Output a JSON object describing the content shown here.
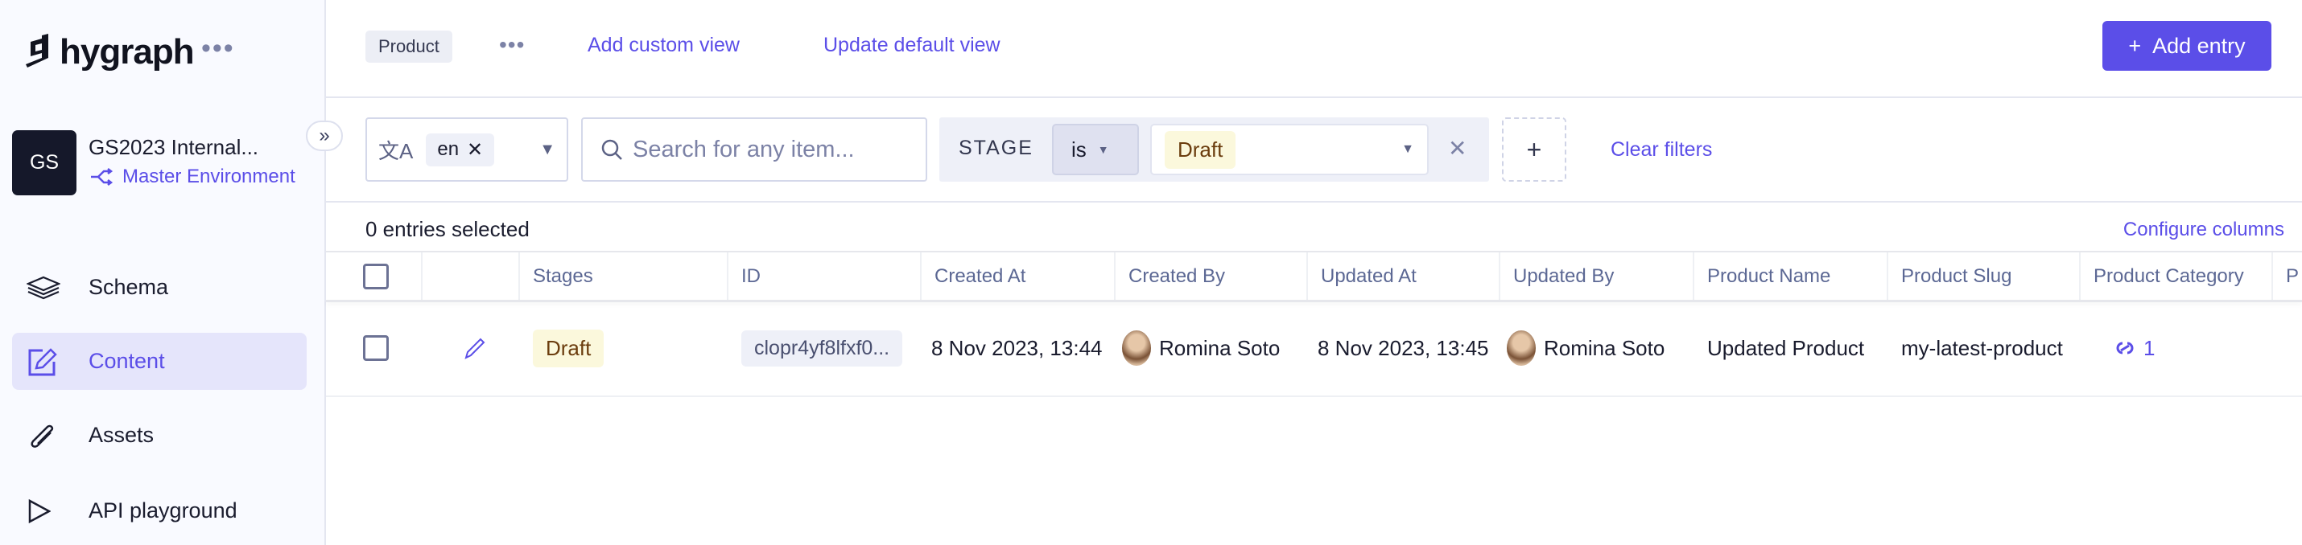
{
  "sidebar": {
    "brand": "hygraph",
    "project_initials": "GS",
    "project_name": "GS2023 Internal...",
    "environment": "Master Environment",
    "items": [
      {
        "label": "Schema",
        "icon": "layers-icon"
      },
      {
        "label": "Content",
        "icon": "edit-icon",
        "active": true
      },
      {
        "label": "Assets",
        "icon": "paperclip-icon"
      },
      {
        "label": "API playground",
        "icon": "play-icon"
      }
    ]
  },
  "header": {
    "model_tag": "Product",
    "add_custom_view": "Add custom view",
    "update_default_view": "Update default view",
    "add_entry": "Add entry"
  },
  "filters": {
    "locale": "en",
    "search_placeholder": "Search for any item...",
    "stage_label": "STAGE",
    "operator": "is",
    "stage_value": "Draft",
    "clear": "Clear filters"
  },
  "table": {
    "selected_text": "0 entries selected",
    "configure_columns": "Configure columns",
    "columns": [
      "",
      "",
      "Stages",
      "ID",
      "Created At",
      "Created By",
      "Updated At",
      "Updated By",
      "Product Name",
      "Product Slug",
      "Product Category",
      "P"
    ],
    "rows": [
      {
        "stage": "Draft",
        "id": "clopr4yf8lfxf0...",
        "created_at": "8 Nov 2023, 13:44",
        "created_by": "Romina Soto",
        "updated_at": "8 Nov 2023, 13:45",
        "updated_by": "Romina Soto",
        "product_name": "Updated Product",
        "product_slug": "my-latest-product",
        "product_category": "1"
      }
    ]
  },
  "colors": {
    "accent": "#5b4ee8",
    "draft_bg": "#fbf8dc",
    "draft_text": "#6b3d0e"
  }
}
